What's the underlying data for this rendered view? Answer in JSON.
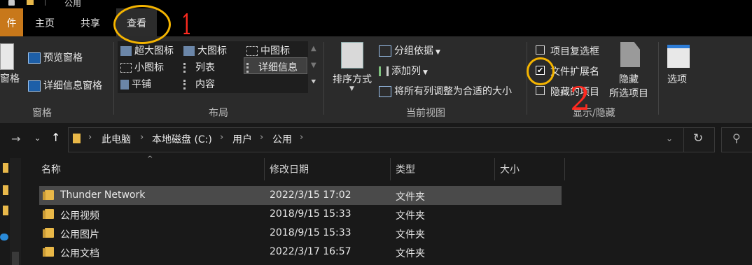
{
  "window": {
    "title": "公用"
  },
  "tabs": {
    "file": "件",
    "home": "主页",
    "share": "共享",
    "view": "查看"
  },
  "ribbon": {
    "panes": {
      "preview": "预览窗格",
      "details": "详细信息窗格",
      "nav_partial": "窗格",
      "label": "窗格"
    },
    "layout": {
      "extra_large": "超大图标",
      "large": "大图标",
      "medium": "中图标",
      "small": "小图标",
      "list": "列表",
      "details": "详细信息",
      "tiles": "平铺",
      "content": "内容",
      "label": "布局"
    },
    "current_view": {
      "sort_by": "排序方式",
      "group_by": "分组依据",
      "add_columns": "添加列",
      "fit_columns": "将所有列调整为合适的大小",
      "label": "当前视图"
    },
    "show_hide": {
      "item_checkboxes": "项目复选框",
      "item_checkboxes_checked": false,
      "file_ext": "文件扩展名",
      "file_ext_checked": true,
      "hidden_items": "隐藏的项目",
      "hidden_items_checked": false,
      "hide_selected_line1": "隐藏",
      "hide_selected_line2": "所选项目",
      "label": "显示/隐藏"
    },
    "options": "选项"
  },
  "address": {
    "crumbs": [
      "此电脑",
      "本地磁盘 (C:)",
      "用户",
      "公用"
    ]
  },
  "columns": {
    "name": "名称",
    "modified": "修改日期",
    "type": "类型",
    "size": "大小"
  },
  "files": [
    {
      "name": "Thunder Network",
      "modified": "2022/3/15 17:02",
      "type": "文件夹",
      "selected": true
    },
    {
      "name": "公用视频",
      "modified": "2018/9/15 15:33",
      "type": "文件夹",
      "selected": false
    },
    {
      "name": "公用图片",
      "modified": "2018/9/15 15:33",
      "type": "文件夹",
      "selected": false
    },
    {
      "name": "公用文档",
      "modified": "2022/3/17 16:57",
      "type": "文件夹",
      "selected": false
    }
  ],
  "annotations": {
    "mark1": "1",
    "mark2": "2"
  },
  "colors": {
    "accent": "#c8781a",
    "annotation_ring": "#f4b400",
    "annotation_ink": "#ff2a20"
  }
}
